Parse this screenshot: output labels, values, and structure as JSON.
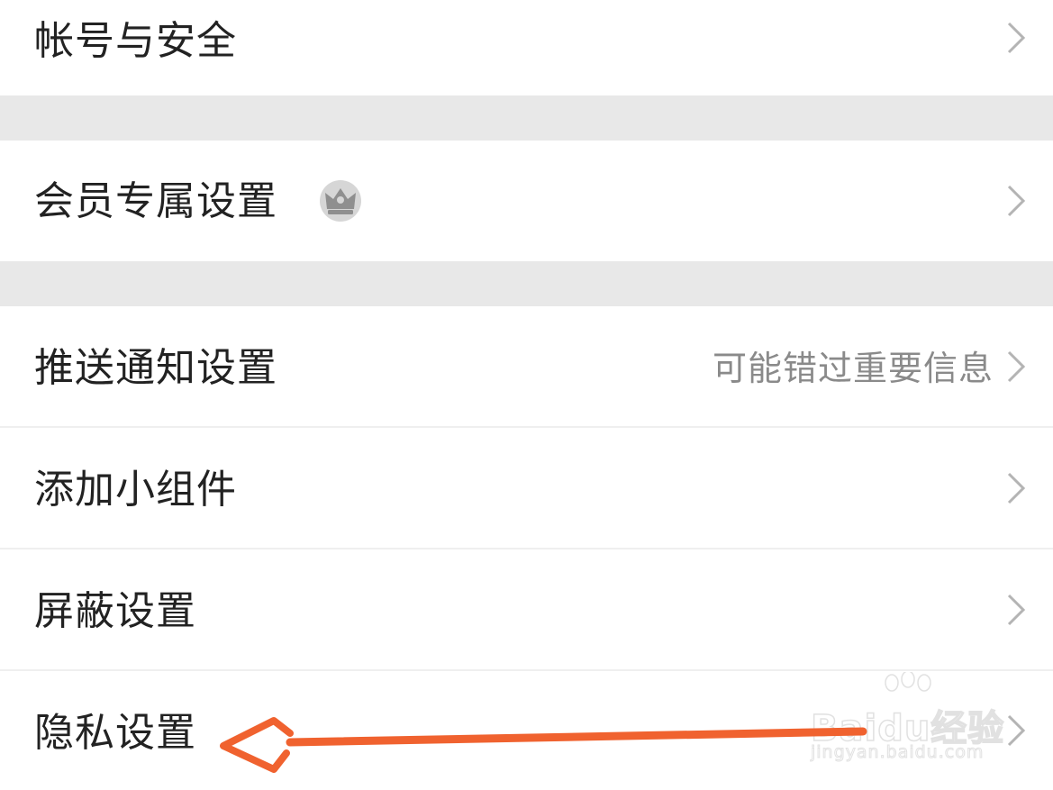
{
  "settings": {
    "account_security": {
      "label": "帐号与安全"
    },
    "member_settings": {
      "label": "会员专属设置",
      "badge_icon": "crown-icon"
    },
    "push_notifications": {
      "label": "推送通知设置",
      "hint": "可能错过重要信息"
    },
    "add_widget": {
      "label": "添加小组件"
    },
    "block_settings": {
      "label": "屏蔽设置"
    },
    "privacy_settings": {
      "label": "隐私设置"
    }
  },
  "annotation": {
    "arrow_color": "#f0622f",
    "target": "privacy_settings"
  },
  "watermark": {
    "logo": "Baidu经验",
    "url": "jingyan.baidu.com"
  }
}
